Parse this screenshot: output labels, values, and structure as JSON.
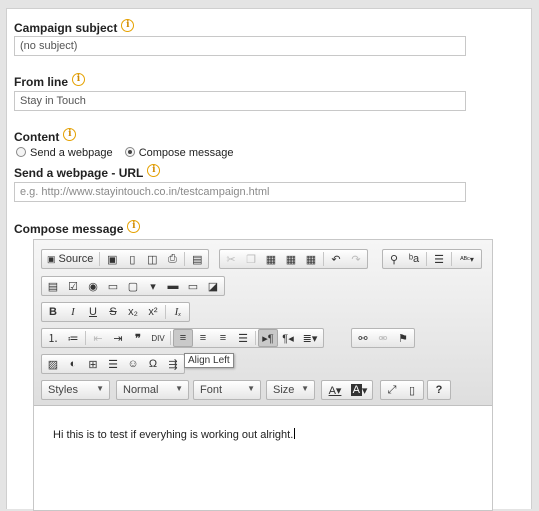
{
  "campaign_subject": {
    "label": "Campaign subject",
    "value": "(no subject)"
  },
  "from_line": {
    "label": "From line",
    "value": "Stay in Touch"
  },
  "content": {
    "label": "Content",
    "option_webpage": "Send a webpage",
    "option_compose": "Compose message",
    "selected": "Compose message"
  },
  "webpage_url": {
    "label": "Send a webpage - URL",
    "placeholder": "e.g. http://www.stayintouch.co.in/testcampaign.html"
  },
  "compose": {
    "label": "Compose message"
  },
  "editor": {
    "source_label": "Source",
    "tooltip": "Align Left",
    "combos": {
      "styles": "Styles",
      "format": "Normal",
      "font": "Font",
      "size": "Size"
    },
    "body_text": "Hi this is to test if everyhing is working out alright."
  },
  "info_icon": "i"
}
